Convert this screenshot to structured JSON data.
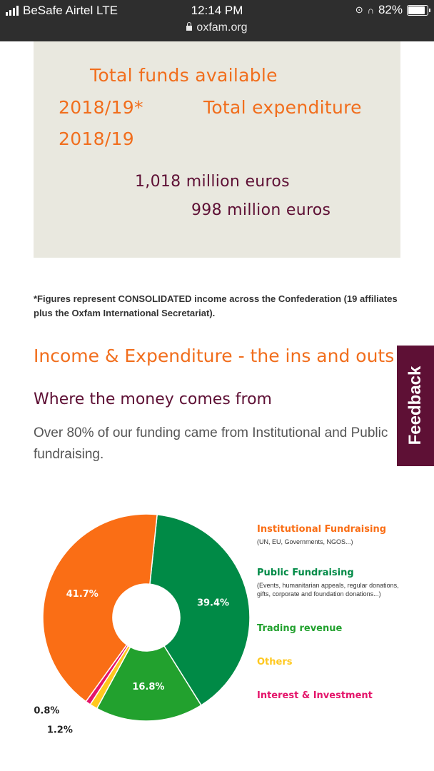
{
  "status_bar": {
    "carrier": "BeSafe Airtel LTE",
    "time": "12:14 PM",
    "battery": "82%",
    "battery_level": 0.82,
    "url": "oxfam.org"
  },
  "summary": {
    "funds_label_line1": "Total funds available",
    "funds_label_line2": "2018/19*",
    "expenditure_label": "Total expenditure",
    "expenditure_year": "2018/19",
    "funds_amount": "1,018 million euros",
    "expenditure_amount": "998 million euros"
  },
  "footnote": "*Figures represent CONSOLIDATED income across the Confederation (19 affiliates plus the Oxfam International Secretariat).",
  "section_heading": "Income & Expenditure - the ins and outs",
  "subheading": "Where the money comes from",
  "paragraph": "Over 80% of our funding came from Institutional and Public fundraising.",
  "feedback_label": "Feedback",
  "colors": {
    "orange": "#f16e1d",
    "maroon": "#5e1035",
    "institutional": "#fa6e15",
    "public": "#008a46",
    "trading": "#22a12e",
    "others": "#ffc81e",
    "interest": "#e4146a"
  },
  "chart_data": {
    "type": "pie",
    "variant": "donut",
    "categories": [
      "Institutional Fundraising",
      "Public Fundraising",
      "Trading revenue",
      "Others",
      "Interest & Investment"
    ],
    "values": [
      41.7,
      39.4,
      16.8,
      1.2,
      0.8
    ],
    "value_labels": [
      "41.7%",
      "39.4%",
      "16.8%",
      "1.2%",
      "0.8%"
    ],
    "legend": [
      {
        "name": "Institutional Fundraising",
        "detail": "(UN, EU, Governments, NGOS...)"
      },
      {
        "name": "Public Fundraising",
        "detail": "(Events, humanitarian appeals, regular donations, gifts, corporate and foundation donations...)"
      },
      {
        "name": "Trading revenue",
        "detail": ""
      },
      {
        "name": "Others",
        "detail": ""
      },
      {
        "name": "Interest & Investment",
        "detail": ""
      }
    ],
    "legend_position": "right"
  }
}
